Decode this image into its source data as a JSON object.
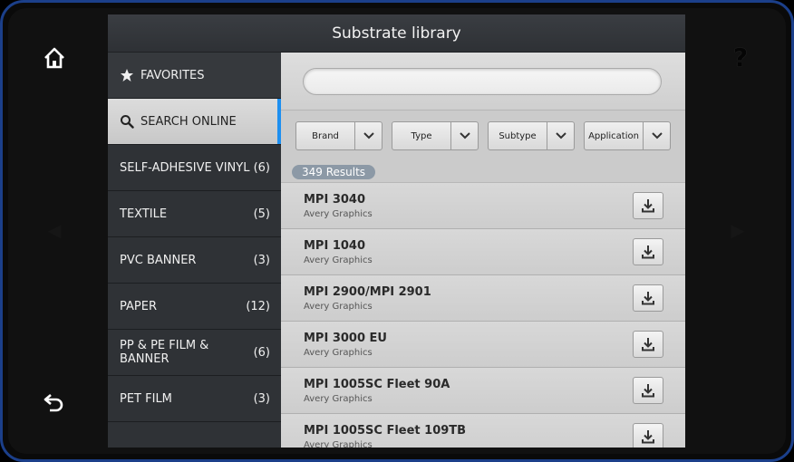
{
  "header": {
    "title": "Substrate library"
  },
  "sidebar": {
    "items": [
      {
        "label": "FAVORITES",
        "count": "",
        "icon": "star-icon"
      },
      {
        "label": "SEARCH ONLINE",
        "count": "",
        "icon": "search-icon"
      },
      {
        "label": "SELF-ADHESIVE VINYL",
        "count": "(6)"
      },
      {
        "label": "TEXTILE",
        "count": "(5)"
      },
      {
        "label": "PVC BANNER",
        "count": "(3)"
      },
      {
        "label": "PAPER",
        "count": "(12)"
      },
      {
        "label": "PP & PE FILM & BANNER",
        "count": "(6)"
      },
      {
        "label": "PET FILM",
        "count": "(3)"
      }
    ]
  },
  "search": {
    "value": "",
    "placeholder": ""
  },
  "filters": [
    {
      "label": "Brand"
    },
    {
      "label": "Type"
    },
    {
      "label": "Subtype"
    },
    {
      "label": "Application"
    }
  ],
  "results": {
    "label": "349 Results"
  },
  "list": [
    {
      "name": "MPI 3040",
      "brand": "Avery Graphics"
    },
    {
      "name": "MPI 1040",
      "brand": "Avery Graphics"
    },
    {
      "name": "MPI 2900/MPI 2901",
      "brand": "Avery Graphics"
    },
    {
      "name": "MPI 3000 EU",
      "brand": "Avery Graphics"
    },
    {
      "name": "MPI 1005SC Fleet 90A",
      "brand": "Avery Graphics"
    },
    {
      "name": "MPI 1005SC Fleet 109TB",
      "brand": "Avery Graphics"
    }
  ],
  "device": {
    "help_glyph": "?",
    "prev_glyph": "◀",
    "next_glyph": "▶"
  },
  "colors": {
    "accent": "#1d8ff0",
    "bezel_edge": "#1b3f8a"
  }
}
